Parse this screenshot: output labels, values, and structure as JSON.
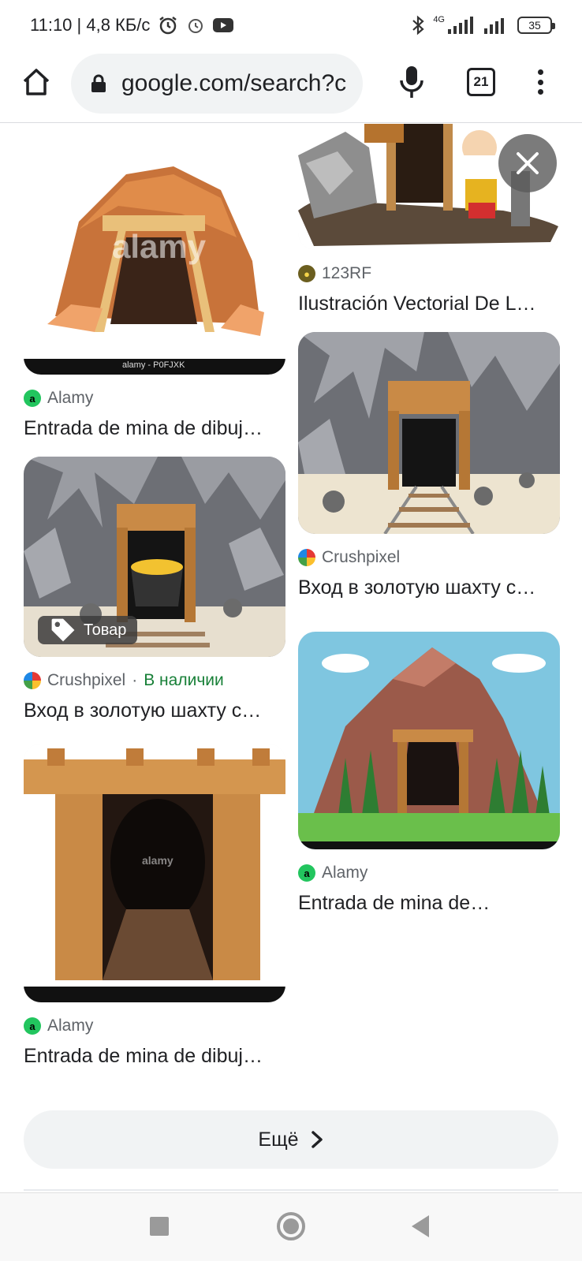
{
  "status_bar": {
    "time_speed": "11:10 | 4,8 КБ/с",
    "network": "4G",
    "battery": "35"
  },
  "browser": {
    "url": "google.com/search?c",
    "tab_count": "21"
  },
  "results": [
    {
      "source": "Alamy",
      "title": "Entrada de mina de dibuj…",
      "favicon_color": "#22c55e",
      "favicon_letter": "a",
      "watermark": "alamy",
      "caption": "alamy - P0FJXK"
    },
    {
      "source": "123RF",
      "title": "Ilustración Vectorial De L…",
      "favicon_color": "#6b5e1f"
    },
    {
      "source": "Crushpixel",
      "stock": "В наличии",
      "title": "Вход в золотую шахту с…",
      "tag": "Товар"
    },
    {
      "source": "Crushpixel",
      "title": "Вход в золотую шахту с…"
    },
    {
      "source": "Alamy",
      "title": "Entrada de mina de dibuj…",
      "favicon_letter": "a",
      "watermark": "alamy"
    },
    {
      "source": "Alamy",
      "title": "Entrada de mina de…",
      "favicon_letter": "a"
    }
  ],
  "separator": "·",
  "more_button": "Ещё"
}
